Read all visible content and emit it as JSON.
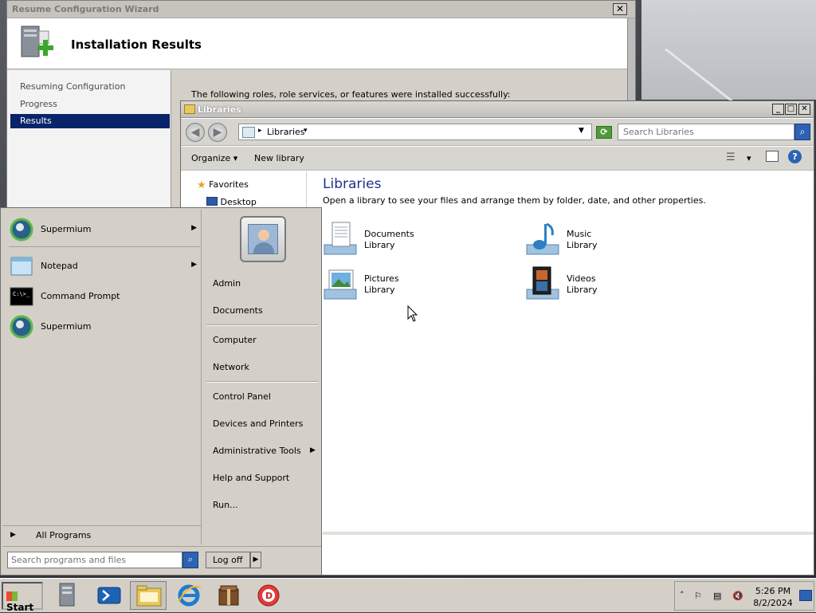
{
  "wizard": {
    "title": "Resume Configuration Wizard",
    "header": "Installation Results",
    "nav": [
      "Resuming Configuration",
      "Progress",
      "Results"
    ],
    "selected_index": 2,
    "message": "The following roles, role services, or features were installed successfully:"
  },
  "explorer": {
    "title": "Libraries",
    "address": "Libraries",
    "search_placeholder": "Search Libraries",
    "toolbar": {
      "organize": "Organize",
      "new_library": "New library"
    },
    "navpane": [
      {
        "label": "Favorites",
        "icon": "star-icon"
      },
      {
        "label": "Desktop",
        "icon": "desktop-icon"
      }
    ],
    "heading": "Libraries",
    "description": "Open a library to see your files and arrange them by folder, date, and other properties.",
    "libraries": [
      {
        "name": "Documents",
        "type": "Library",
        "icon": "documents-library-icon"
      },
      {
        "name": "Music",
        "type": "Library",
        "icon": "music-library-icon"
      },
      {
        "name": "Pictures",
        "type": "Library",
        "icon": "pictures-library-icon"
      },
      {
        "name": "Videos",
        "type": "Library",
        "icon": "videos-library-icon"
      }
    ]
  },
  "startmenu": {
    "left_items": [
      {
        "label": "Supermium",
        "icon": "supermium-icon",
        "submenu": true
      },
      {
        "label": "Notepad",
        "icon": "notepad-icon",
        "submenu": true
      },
      {
        "label": "Command Prompt",
        "icon": "command-prompt-icon",
        "submenu": false
      },
      {
        "label": "Supermium",
        "icon": "supermium-icon",
        "submenu": false
      }
    ],
    "all_programs": "All Programs",
    "right_items": [
      "Admin",
      "Documents",
      "Computer",
      "Network",
      "Control Panel",
      "Devices and Printers",
      "Administrative Tools",
      "Help and Support",
      "Run..."
    ],
    "search_placeholder": "Search programs and files",
    "logoff": "Log off"
  },
  "taskbar": {
    "start": "Start",
    "pinned": [
      "server-manager-icon",
      "powershell-icon",
      "explorer-icon",
      "internet-explorer-icon",
      "archiver-icon",
      "browser-icon"
    ],
    "clock_time": "5:26 PM",
    "clock_date": "8/2/2024"
  },
  "colors": {
    "selection": "#0a246a",
    "heading_blue": "#1e3287",
    "window_face": "#d4d0c8"
  }
}
